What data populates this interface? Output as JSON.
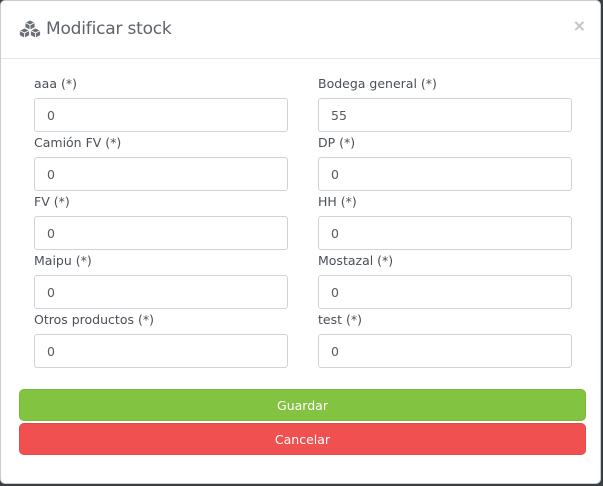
{
  "modal": {
    "title": "Modificar stock",
    "icon": "cubes-icon",
    "close_label": "×"
  },
  "fields": [
    {
      "label": "aaa (*)",
      "value": "0"
    },
    {
      "label": "Bodega general (*)",
      "value": "55"
    },
    {
      "label": "Camión FV (*)",
      "value": "0"
    },
    {
      "label": "DP (*)",
      "value": "0"
    },
    {
      "label": "FV (*)",
      "value": "0"
    },
    {
      "label": "HH (*)",
      "value": "0"
    },
    {
      "label": "Maipu (*)",
      "value": "0"
    },
    {
      "label": "Mostazal (*)",
      "value": "0"
    },
    {
      "label": "Otros productos (*)",
      "value": "0"
    },
    {
      "label": "test (*)",
      "value": "0"
    }
  ],
  "buttons": {
    "save_label": "Guardar",
    "cancel_label": "Cancelar"
  },
  "colors": {
    "save": "#82c341",
    "cancel": "#f05050"
  }
}
